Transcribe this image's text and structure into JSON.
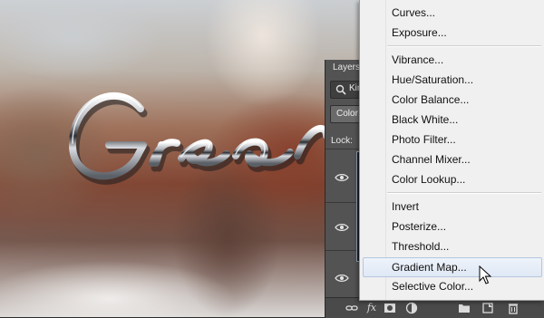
{
  "canvas": {
    "text": "Great"
  },
  "layers_panel": {
    "tab_label": "Layers",
    "search_text": "Kin",
    "blend_mode": "Color",
    "lock_label": "Lock:",
    "bottom_icons": [
      "link-icon",
      "fx-icon",
      "mask-icon",
      "adjustment-icon",
      "folder-icon",
      "new-layer-icon",
      "trash-icon"
    ],
    "fx_label": "fx"
  },
  "menu": {
    "items": [
      {
        "label": "Curves..."
      },
      {
        "label": "Exposure..."
      },
      {
        "label": "Vibrance..."
      },
      {
        "label": "Hue/Saturation..."
      },
      {
        "label": "Color Balance..."
      },
      {
        "label": "Black  White..."
      },
      {
        "label": "Photo Filter..."
      },
      {
        "label": "Channel Mixer..."
      },
      {
        "label": "Color Lookup..."
      },
      {
        "label": "Invert"
      },
      {
        "label": "Posterize..."
      },
      {
        "label": "Threshold..."
      },
      {
        "label": "Gradient Map..."
      },
      {
        "label": "Selective Color..."
      }
    ],
    "highlighted": "Gradient Map..."
  }
}
